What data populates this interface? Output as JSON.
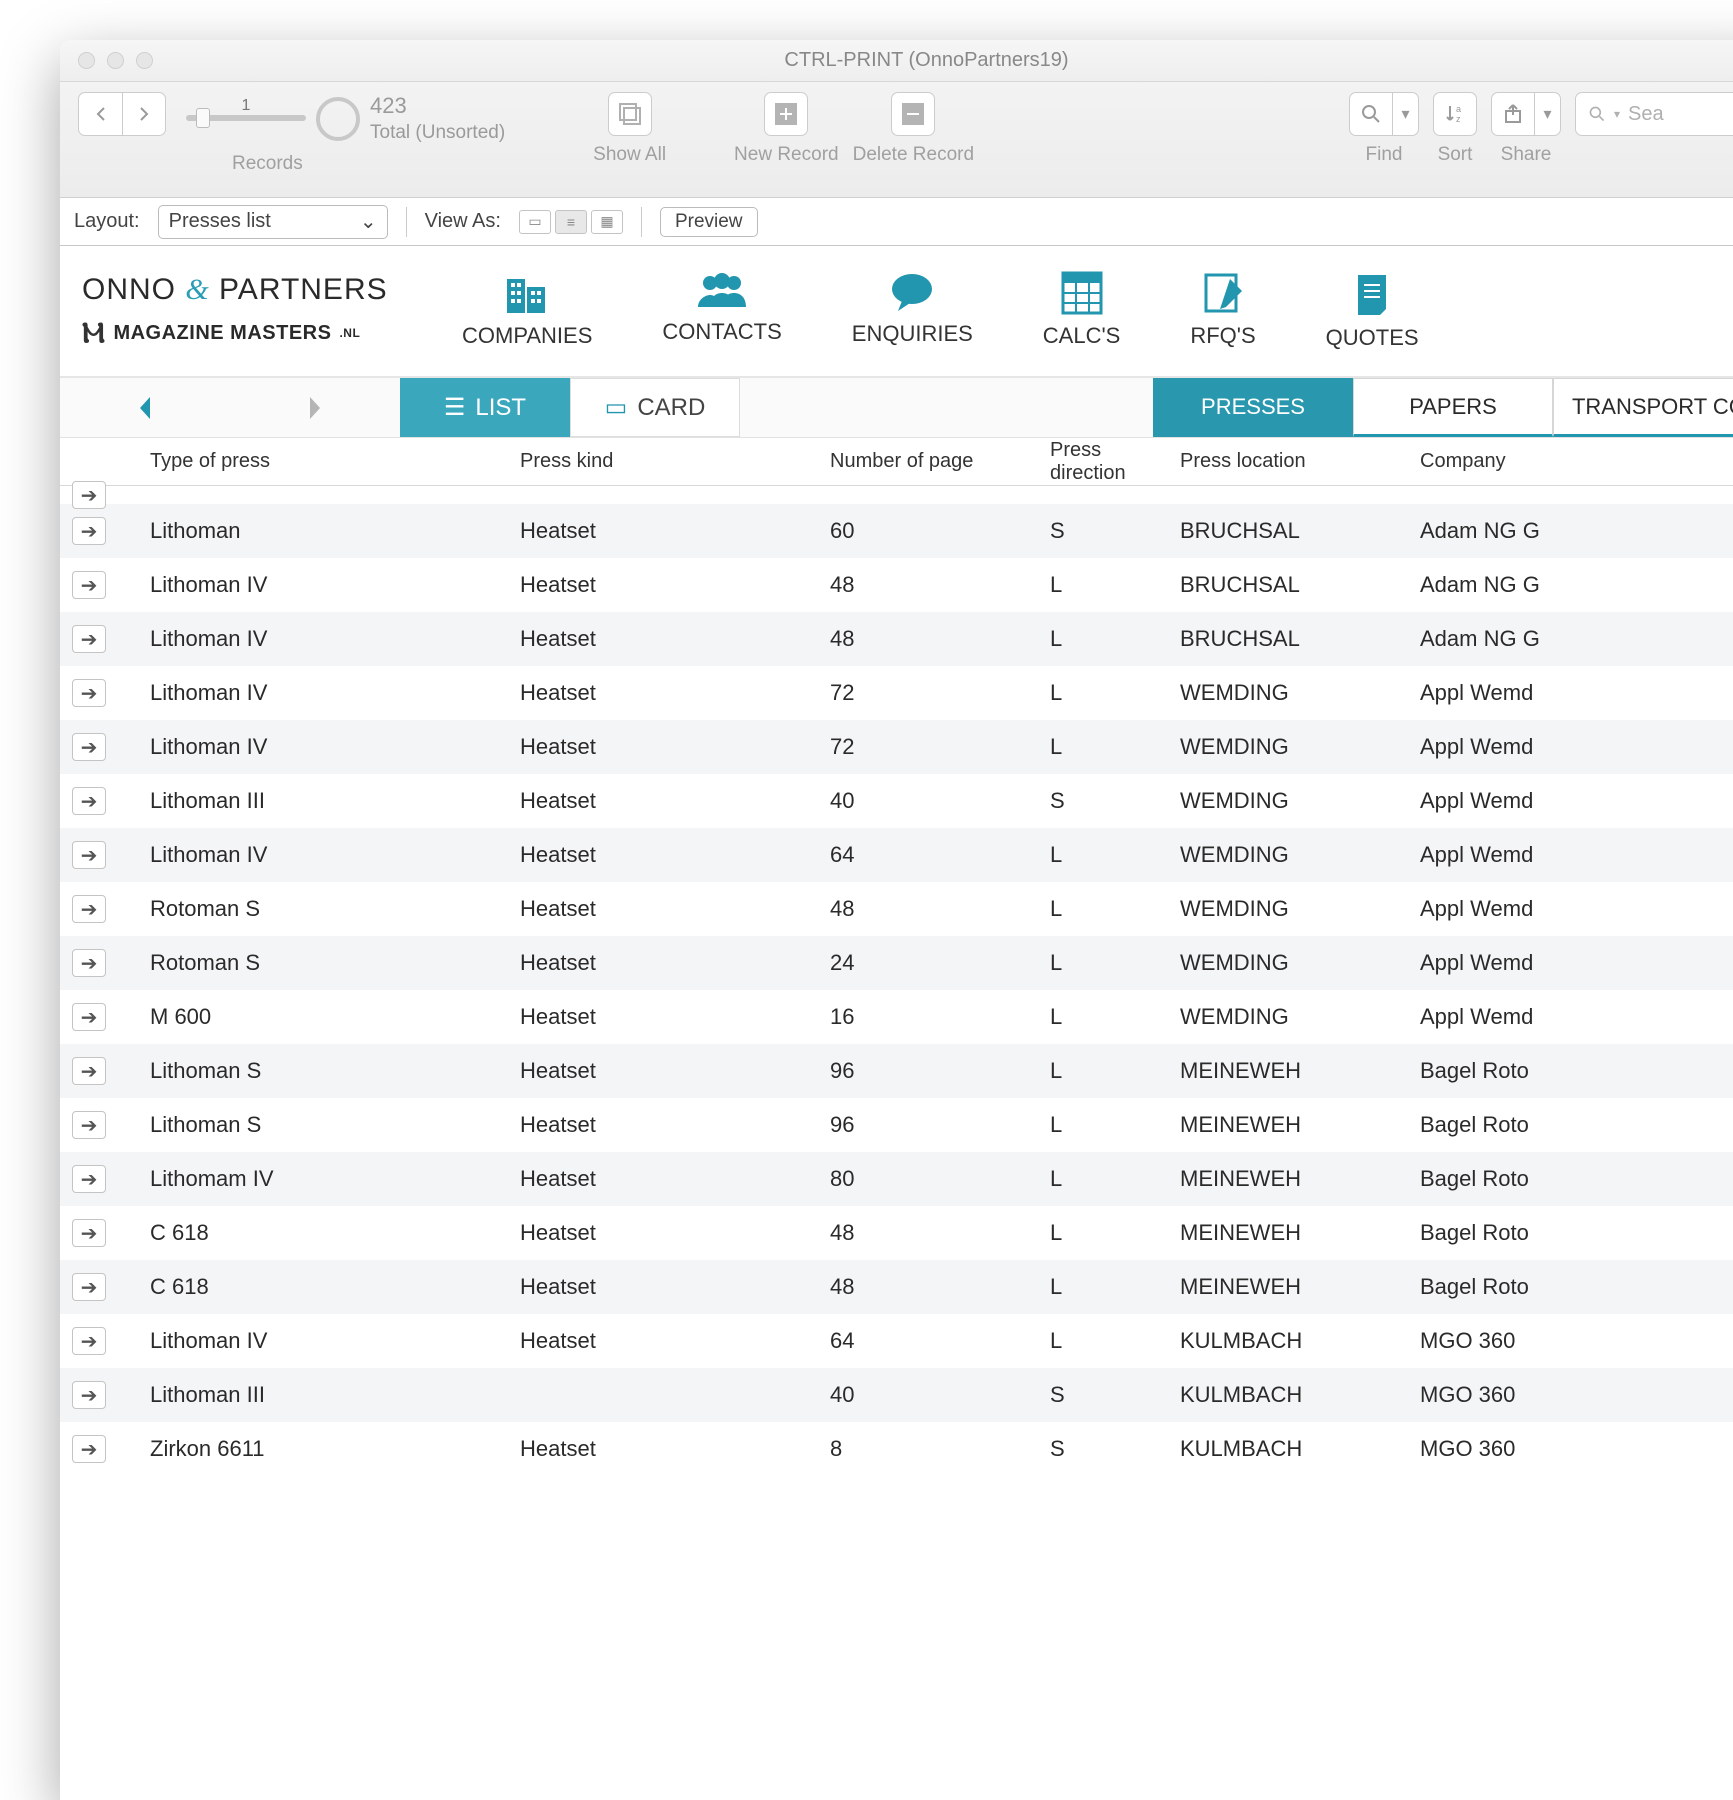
{
  "window": {
    "title": "CTRL-PRINT (OnnoPartners19)"
  },
  "toolbar": {
    "records_count": "423",
    "records_status": "Total (Unsorted)",
    "records_label": "Records",
    "slider_value": "1",
    "show_all": "Show All",
    "new_record": "New Record",
    "delete_record": "Delete Record",
    "find": "Find",
    "sort": "Sort",
    "share": "Share",
    "search_placeholder": "Sea"
  },
  "layoutrow": {
    "layout_label": "Layout:",
    "layout_value": "Presses list",
    "viewas_label": "View As:",
    "preview": "Preview"
  },
  "brand": {
    "line1_a": "ONNO ",
    "line1_amp": "&",
    "line1_b": " PARTNERS",
    "line2": "MAGAZINE MASTERS",
    "line2_suffix": ".NL"
  },
  "nav": {
    "companies": "COMPANIES",
    "contacts": "CONTACTS",
    "enquiries": "ENQUIRIES",
    "calcs": "CALC'S",
    "rfqs": "RFQ'S",
    "quotes": "QUOTES"
  },
  "viewtabs": {
    "list": "LIST",
    "card": "CARD"
  },
  "sectiontabs": {
    "presses": "PRESSES",
    "papers": "PAPERS",
    "transport": "TRANSPORT COST"
  },
  "columns": {
    "type": "Type of press",
    "kind": "Press kind",
    "pages": "Number of page",
    "dir": "Press direction",
    "loc": "Press location",
    "company": "Company"
  },
  "rows": [
    {
      "type": "Lithoman",
      "kind": "Heatset",
      "pages": "60",
      "dir": "S",
      "loc": "BRUCHSAL",
      "company": "Adam NG G"
    },
    {
      "type": "Lithoman IV",
      "kind": "Heatset",
      "pages": "48",
      "dir": "L",
      "loc": "BRUCHSAL",
      "company": "Adam NG G"
    },
    {
      "type": "Lithoman IV",
      "kind": "Heatset",
      "pages": "48",
      "dir": "L",
      "loc": "BRUCHSAL",
      "company": "Adam NG G"
    },
    {
      "type": "Lithoman IV",
      "kind": "Heatset",
      "pages": "72",
      "dir": "L",
      "loc": "WEMDING",
      "company": "Appl Wemd"
    },
    {
      "type": "Lithoman IV",
      "kind": "Heatset",
      "pages": "72",
      "dir": "L",
      "loc": "WEMDING",
      "company": "Appl Wemd"
    },
    {
      "type": "Lithoman III",
      "kind": "Heatset",
      "pages": "40",
      "dir": "S",
      "loc": "WEMDING",
      "company": "Appl Wemd"
    },
    {
      "type": "Lithoman IV",
      "kind": "Heatset",
      "pages": "64",
      "dir": "L",
      "loc": "WEMDING",
      "company": "Appl Wemd"
    },
    {
      "type": "Rotoman S",
      "kind": "Heatset",
      "pages": "48",
      "dir": "L",
      "loc": "WEMDING",
      "company": "Appl Wemd"
    },
    {
      "type": "Rotoman S",
      "kind": "Heatset",
      "pages": "24",
      "dir": "L",
      "loc": "WEMDING",
      "company": "Appl Wemd"
    },
    {
      "type": "M 600",
      "kind": "Heatset",
      "pages": "16",
      "dir": "L",
      "loc": "WEMDING",
      "company": "Appl Wemd"
    },
    {
      "type": "Lithoman S",
      "kind": "Heatset",
      "pages": "96",
      "dir": "L",
      "loc": "MEINEWEH",
      "company": "Bagel Roto"
    },
    {
      "type": "Lithoman S",
      "kind": "Heatset",
      "pages": "96",
      "dir": "L",
      "loc": "MEINEWEH",
      "company": "Bagel Roto"
    },
    {
      "type": "Lithomam IV",
      "kind": "Heatset",
      "pages": "80",
      "dir": "L",
      "loc": "MEINEWEH",
      "company": "Bagel Roto"
    },
    {
      "type": "C 618",
      "kind": "Heatset",
      "pages": "48",
      "dir": "L",
      "loc": "MEINEWEH",
      "company": "Bagel Roto"
    },
    {
      "type": "C 618",
      "kind": "Heatset",
      "pages": "48",
      "dir": "L",
      "loc": "MEINEWEH",
      "company": "Bagel Roto"
    },
    {
      "type": "Lithoman IV",
      "kind": "Heatset",
      "pages": "64",
      "dir": "L",
      "loc": "KULMBACH",
      "company": "MGO 360"
    },
    {
      "type": "Lithoman III",
      "kind": "",
      "pages": "40",
      "dir": "S",
      "loc": "KULMBACH",
      "company": "MGO 360"
    },
    {
      "type": "Zirkon 6611",
      "kind": "Heatset",
      "pages": "8",
      "dir": "S",
      "loc": "KULMBACH",
      "company": "MGO 360"
    }
  ]
}
